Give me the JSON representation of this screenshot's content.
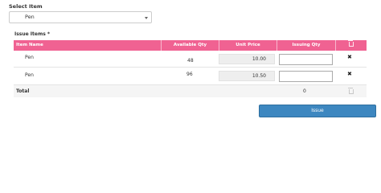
{
  "select_item": {
    "label": "Select Item",
    "value": "Pen"
  },
  "issue_items": {
    "label": "Issue Items *",
    "headers": [
      "Item Name",
      "Available Qty",
      "Unit Price",
      "Issuing Qty"
    ],
    "rows": [
      {
        "item": "Pen",
        "available_qty": "48",
        "unit_price": "10.00",
        "issuing_qty": ""
      },
      {
        "item": "Pen",
        "available_qty": "96",
        "unit_price": "10.50",
        "issuing_qty": ""
      }
    ],
    "total_label": "Total",
    "total_value": "0",
    "remove_symbol": "✖"
  },
  "actions": {
    "issue_label": "Issue"
  },
  "colors": {
    "header_bg": "#f06292",
    "button_bg": "#3d87c0"
  }
}
